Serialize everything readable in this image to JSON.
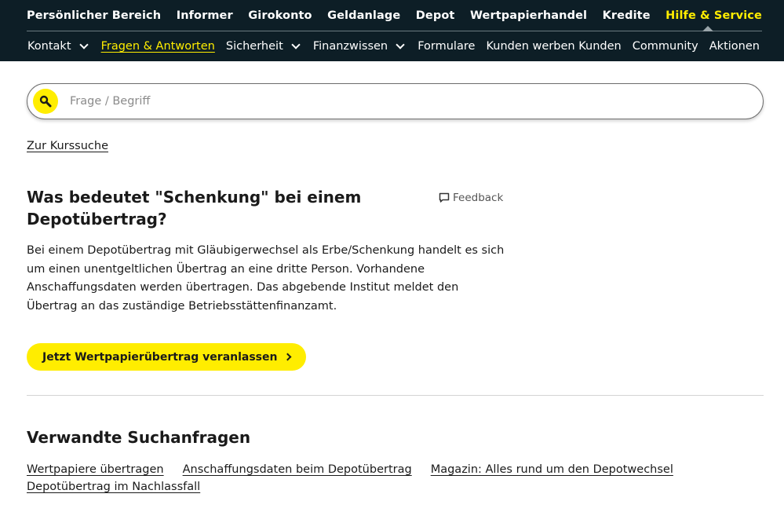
{
  "main_nav": [
    "Persönlicher Bereich",
    "Informer",
    "Girokonto",
    "Geldanlage",
    "Depot",
    "Wertpapierhandel",
    "Kredite",
    "Hilfe & Service"
  ],
  "sub_nav": [
    "Kontakt",
    "Fragen & Antworten",
    "Sicherheit",
    "Finanzwissen",
    "Formulare",
    "Kunden werben Kunden",
    "Community",
    "Aktionen"
  ],
  "search": {
    "placeholder": "Frage / Begriff"
  },
  "kurs_link": "Zur Kurssuche",
  "question": {
    "title": "Was bedeutet \"Schenkung\" bei einem Depotübertrag?",
    "feedback": "Feedback",
    "answer": "Bei einem Depotübertrag mit Gläubigerwechsel als Erbe/Schenkung handelt es sich um einen unentgeltlichen Übertrag an eine dritte Person. Vorhandene Anschaffungsdaten werden übertragen. Das abgebende Institut meldet den Übertrag an das zuständige Betriebsstättenfinanzamt.",
    "cta": "Jetzt Wertpapierübertrag veranlassen"
  },
  "related": {
    "title": "Verwandte Suchanfragen",
    "links": [
      "Wertpapiere übertragen",
      "Anschaffungsdaten beim Depotübertrag",
      "Magazin: Alles rund um den Depotwechsel",
      "Depotübertrag im Nachlassfall"
    ]
  },
  "colors": {
    "header_bg": "#0d1e26",
    "accent": "#ffed00"
  }
}
